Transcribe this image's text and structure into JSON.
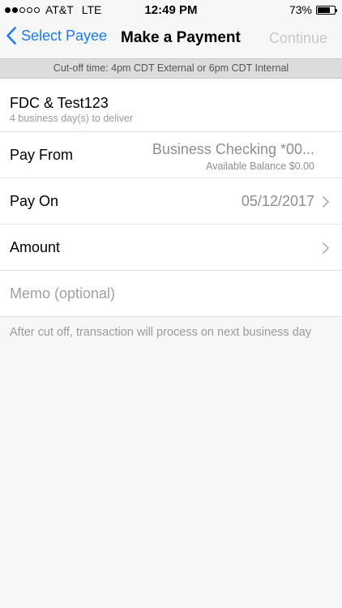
{
  "status_bar": {
    "carrier": "AT&T",
    "network": "LTE",
    "time": "12:49 PM",
    "battery": "73%",
    "battery_level": 0.73,
    "signal_bars": 2
  },
  "nav": {
    "back_label": "Select Payee",
    "title": "Make a Payment",
    "continue_label": "Continue"
  },
  "cutoff_text": "Cut-off time: 4pm CDT External or 6pm CDT Internal",
  "payee": {
    "name": "FDC & Test123",
    "delivery": "4 business day(s) to deliver"
  },
  "pay_from": {
    "label": "Pay From",
    "account": "Business Checking *00...",
    "balance": "Available Balance $0.00"
  },
  "pay_on": {
    "label": "Pay On",
    "date": "05/12/2017"
  },
  "amount": {
    "label": "Amount",
    "value": ""
  },
  "memo": {
    "placeholder": "Memo (optional)"
  },
  "note": "After cut off, transaction will process on next business day",
  "colors": {
    "accent": "#1a7cf8",
    "disabled": "#c7c7cc",
    "secondary": "#8e8e93"
  }
}
